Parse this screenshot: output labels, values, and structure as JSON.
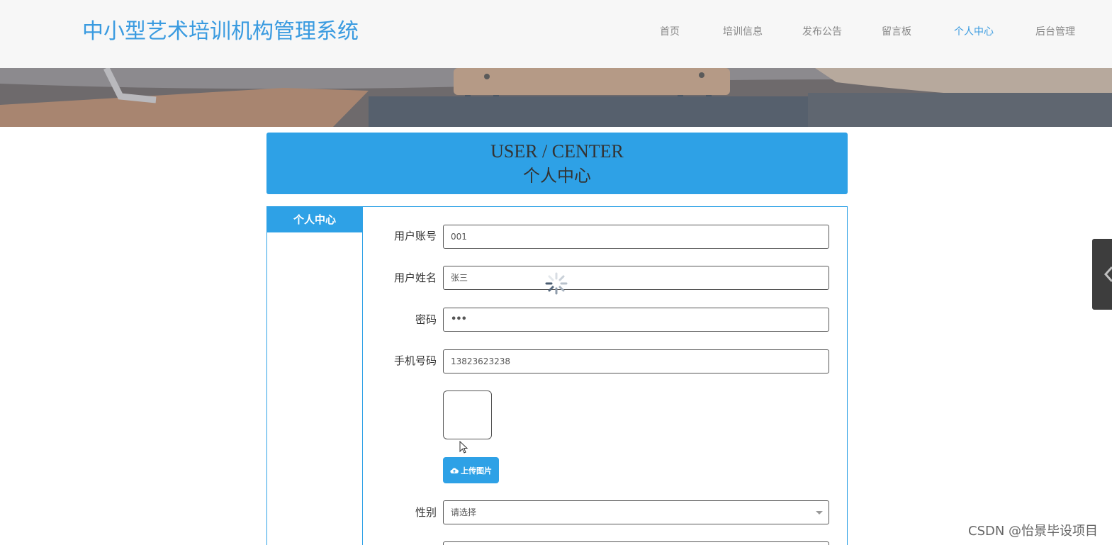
{
  "header": {
    "title": "中小型艺术培训机构管理系统",
    "nav": [
      {
        "label": "首页",
        "active": false
      },
      {
        "label": "培训信息",
        "active": false
      },
      {
        "label": "发布公告",
        "active": false
      },
      {
        "label": "留言板",
        "active": false
      },
      {
        "label": "个人中心",
        "active": true
      },
      {
        "label": "后台管理",
        "active": false
      }
    ]
  },
  "page_heading": {
    "en": "USER / CENTER",
    "cn": "个人中心"
  },
  "sidebar": {
    "items": [
      {
        "label": "个人中心",
        "active": true
      }
    ]
  },
  "form": {
    "account": {
      "label": "用户账号",
      "value": "001"
    },
    "name": {
      "label": "用户姓名",
      "value": "张三"
    },
    "password": {
      "label": "密码",
      "value": "•••"
    },
    "phone": {
      "label": "手机号码",
      "value": "13823623238"
    },
    "avatar": {
      "upload_label": "上传图片",
      "upload_icon": "cloud-upload-icon"
    },
    "gender": {
      "label": "性别",
      "placeholder": "请选择"
    }
  },
  "watermark": "CSDN @怡景毕设项目",
  "colors": {
    "accent": "#2ea1e6",
    "title": "#3a9be0",
    "header_bg": "#f7f7f7",
    "nav_text": "#888888"
  }
}
